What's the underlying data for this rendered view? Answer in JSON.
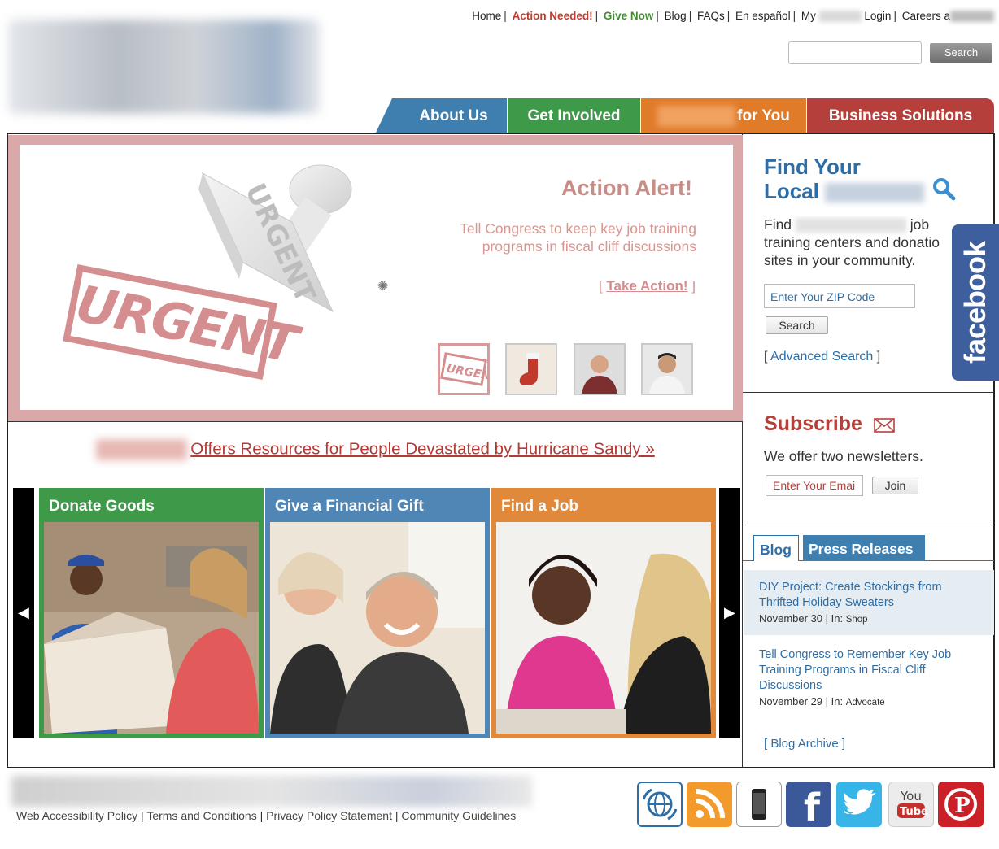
{
  "top_links": {
    "home": "Home",
    "action_needed": "Action Needed!",
    "give_now": "Give Now",
    "blog": "Blog",
    "faqs": "FAQs",
    "espanol": "En español",
    "my": "My",
    "login": "Login",
    "careers": "Careers a"
  },
  "search": {
    "button": "Search"
  },
  "nav": {
    "about": "About Us",
    "involved": "Get Involved",
    "foryou": "for You",
    "business": "Business Solutions"
  },
  "hero": {
    "stamp_text": "URGENT",
    "title": "Action Alert!",
    "text": "Tell Congress to keep key job training programs in fiscal cliff discussions",
    "link_open": "[ ",
    "link": "Take Action!",
    "link_close": " ]"
  },
  "sandy": {
    "link": "Offers Resources for People Devastated by Hurricane Sandy »"
  },
  "cards": {
    "donate": "Donate Goods",
    "gift": "Give a Financial Gift",
    "job": "Find a Job"
  },
  "find_local": {
    "title_line1": "Find Your",
    "title_line2": "Local",
    "text_find": "Find",
    "text_rest1": " job",
    "text_rest2": "training centers and donatio",
    "text_rest3": "sites in your community.",
    "zip_placeholder": "Enter Your ZIP Code",
    "search_button": "Search",
    "adv_open": "[ ",
    "adv_link": "Advanced Search",
    "adv_close": " ]"
  },
  "facebook": "facebook",
  "subscribe": {
    "title": "Subscribe",
    "text": "We offer two newsletters.",
    "email_placeholder": "Enter Your Emai",
    "join": "Join"
  },
  "blog_tabs": {
    "blog": "Blog",
    "press": "Press Releases"
  },
  "posts": [
    {
      "title": "DIY Project: Create Stockings from Thrifted Holiday Sweaters",
      "date": "November 30 | In: ",
      "category": "Shop"
    },
    {
      "title": "Tell Congress to Remember Key Job Training Programs in Fiscal Cliff Discussions",
      "date": "November 29 | In: ",
      "category": "Advocate"
    }
  ],
  "blog_archive": "[ Blog Archive ]",
  "footer": {
    "accessibility": "Web Accessibility Policy",
    "terms": "Terms and Conditions",
    "privacy": "Privacy Policy Statement",
    "community": "Community Guidelines"
  },
  "social_icons": [
    "globe-icon",
    "rss-icon",
    "mobile-icon",
    "facebook-icon",
    "twitter-icon",
    "youtube-icon",
    "pinterest-icon"
  ],
  "social_labels": {
    "facebook": "f",
    "pinterest": "P",
    "youtube_top": "You",
    "youtube_bottom": "Tube"
  },
  "colors": {
    "blue": "#3f7fb0",
    "green": "#3e9a48",
    "orange": "#e07b2a",
    "red": "#b5403b"
  }
}
